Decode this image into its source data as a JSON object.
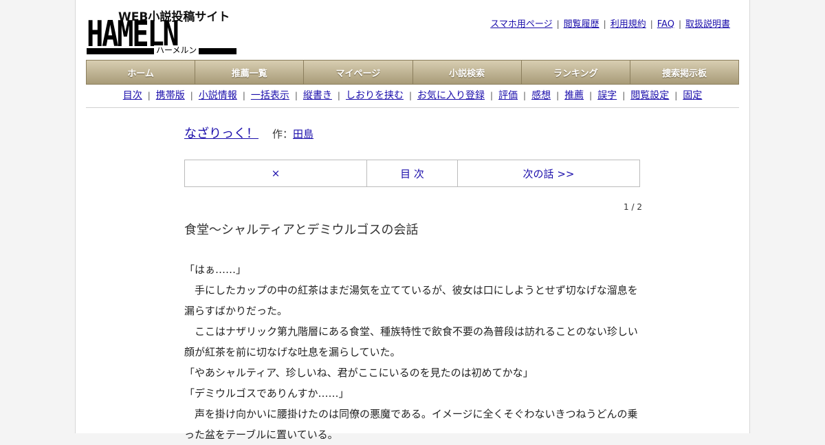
{
  "logo": {
    "sub": "WEB小説投稿サイト",
    "main": "HAMELN",
    "kana": "ハーメルン"
  },
  "top_links": [
    "スマホ用ページ",
    "閲覧履歴",
    "利用規約",
    "FAQ",
    "取扱説明書"
  ],
  "main_nav": [
    "ホーム",
    "推薦一覧",
    "マイページ",
    "小説検索",
    "ランキング",
    "捜索掲示板"
  ],
  "sub_nav": [
    "目次",
    "携帯版",
    "小説情報",
    "一括表示",
    "縦書き",
    "しおりを挟む",
    "お気に入り登録",
    "評価",
    "感想",
    "推薦",
    "誤字",
    "閲覧設定",
    "固定"
  ],
  "novel": {
    "title": "なざりっく！",
    "author_label": "作：",
    "author": "田島"
  },
  "pager": {
    "close": "×",
    "toc": "目 次",
    "next": "次の話 >>"
  },
  "page_count": "1 / 2",
  "chapter_title": "食堂～シャルティアとデミウルゴスの会話",
  "paragraphs": [
    "「はぁ……」",
    "　手にしたカップの中の紅茶はまだ湯気を立てているが、彼女は口にしようとせず切なげな溜息を漏らすばかりだった。",
    "　ここはナザリック第九階層にある食堂、種族特性で飲食不要の為普段は訪れることのない珍しい顔が紅茶を前に切なげな吐息を漏らしていた。",
    "「やあシャルティア、珍しいね、君がここにいるのを見たのは初めてかな」",
    "「デミウルゴスでありんすか……」",
    "　声を掛け向かいに腰掛けたのは同僚の悪魔である。イメージに全くそぐわないきつねうどんの乗った盆をテーブルに置いている。"
  ]
}
